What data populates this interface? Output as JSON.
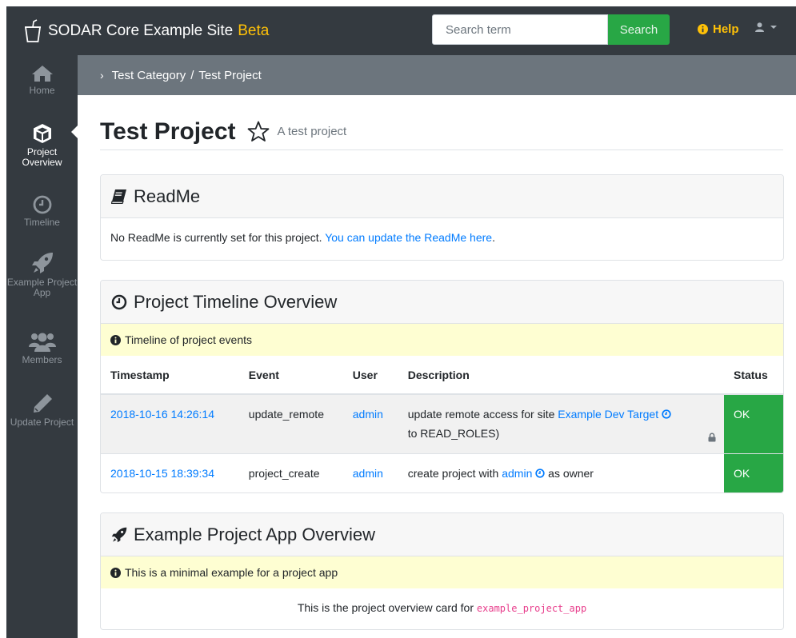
{
  "navbar": {
    "brand_name": "SODAR Core Example Site",
    "brand_tag": "Beta",
    "search_placeholder": "Search term",
    "search_button": "Search",
    "help_label": "Help"
  },
  "sidebar": {
    "items": [
      {
        "label": "Home",
        "icon": "home-icon"
      },
      {
        "label": "Project Overview",
        "icon": "cube-icon",
        "active": true
      },
      {
        "label": "Timeline",
        "icon": "clock-icon"
      },
      {
        "label": "Example Project App",
        "icon": "rocket-icon"
      },
      {
        "label": "Members",
        "icon": "users-icon"
      },
      {
        "label": "Update Project",
        "icon": "pencil-icon"
      }
    ]
  },
  "breadcrumb": {
    "category": "Test Category",
    "separator": "/",
    "project": "Test Project"
  },
  "page": {
    "title": "Test Project",
    "subtitle": "A test project"
  },
  "readme": {
    "header": "ReadMe",
    "text": "No ReadMe is currently set for this project.",
    "link": "You can update the ReadMe here",
    "suffix": "."
  },
  "timeline": {
    "header": "Project Timeline Overview",
    "alert": "Timeline of project events",
    "columns": [
      "Timestamp",
      "Event",
      "User",
      "Description",
      "Status"
    ],
    "rows": [
      {
        "timestamp": "2018-10-16 14:26:14",
        "event": "update_remote",
        "user": "admin",
        "desc_prefix": "update remote access for site",
        "desc_link": "Example Dev Target",
        "desc_suffix": "to READ_ROLES)",
        "status": "OK"
      },
      {
        "timestamp": "2018-10-15 18:39:34",
        "event": "project_create",
        "user": "admin",
        "desc_prefix": "create project with",
        "desc_link": "admin",
        "desc_suffix": "as owner",
        "status": "OK"
      }
    ]
  },
  "example_app": {
    "header": "Example Project App Overview",
    "alert": "This is a minimal example for a project app",
    "body_text": "This is the project overview card for",
    "body_code": "example_project_app"
  },
  "colors": {
    "navbar_bg": "#343a40",
    "brand_accent": "#ffc107",
    "success": "#28a745",
    "link": "#007bff",
    "breadcrumb_bg": "#6c757d",
    "alert_bg": "#fefed2"
  }
}
